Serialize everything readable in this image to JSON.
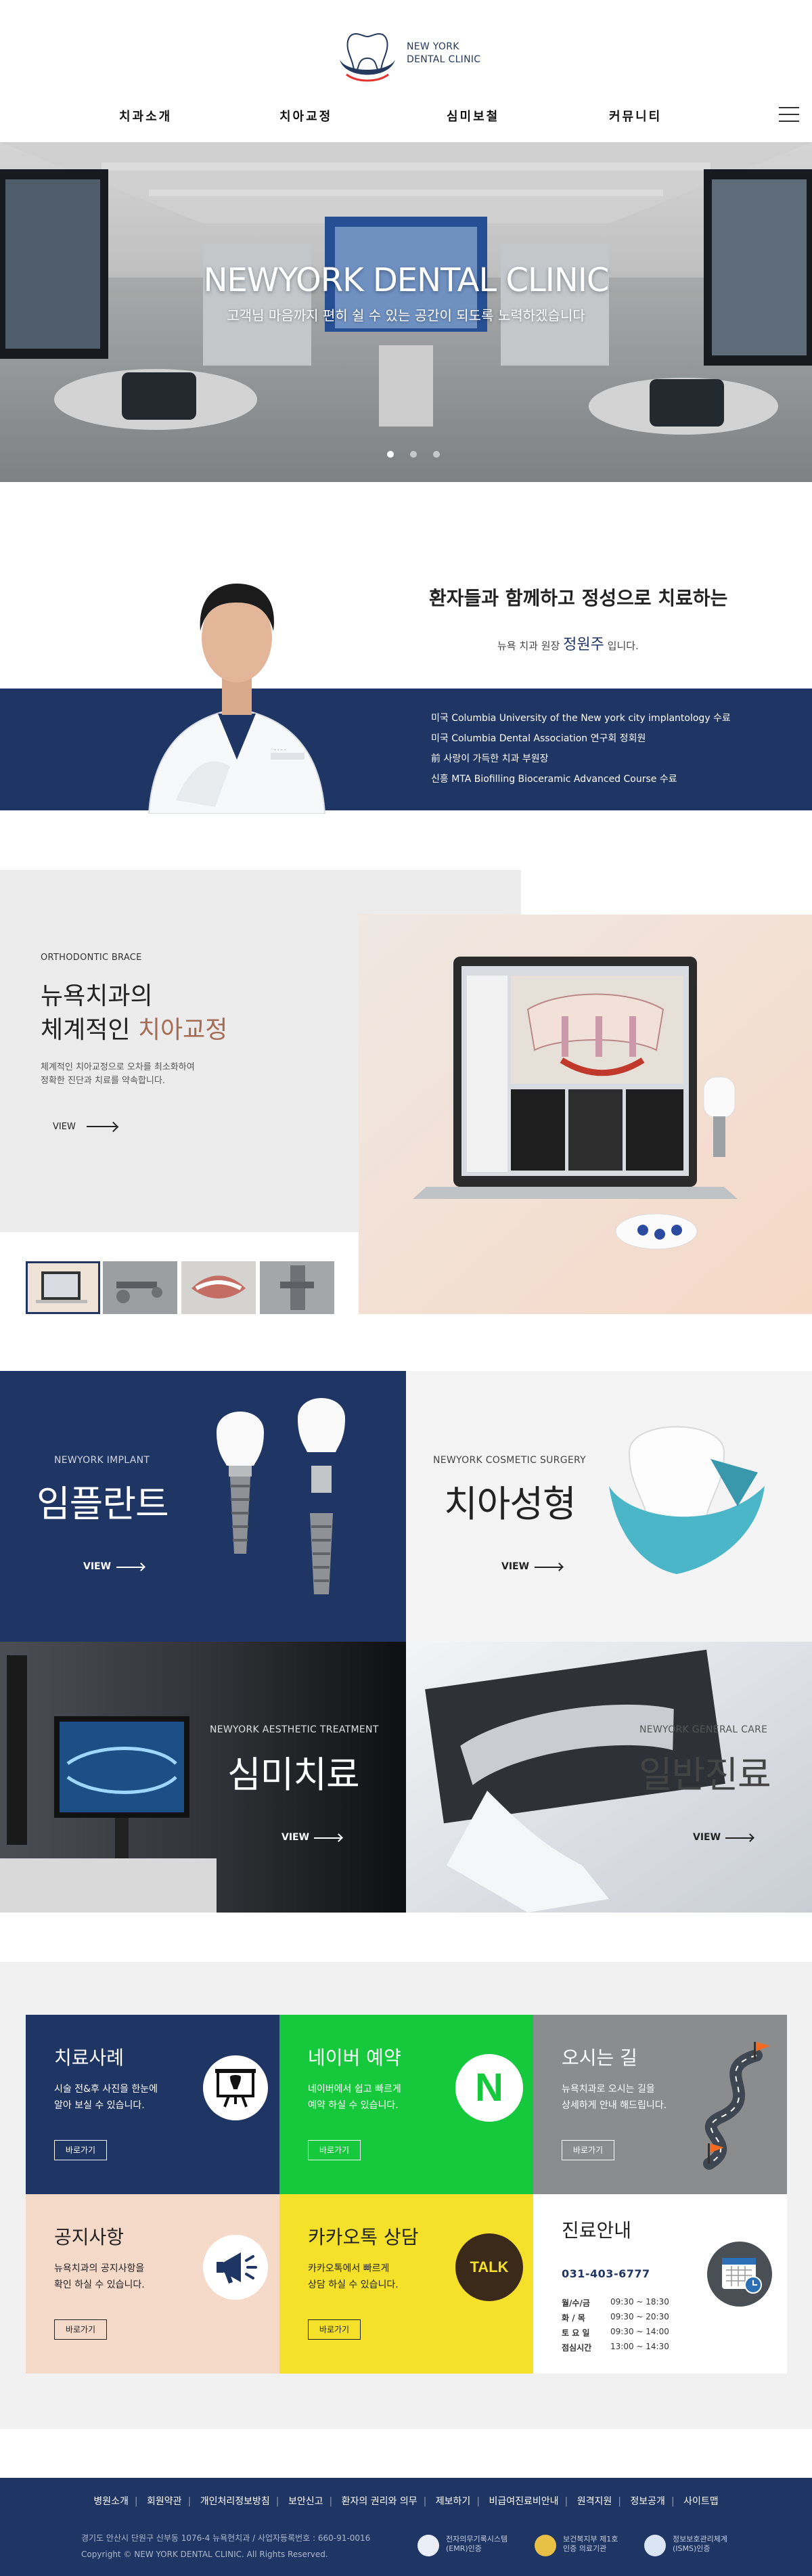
{
  "header": {
    "logo_line1": "NEW YORK",
    "logo_line2": "DENTAL CLINIC",
    "nav": [
      "치과소개",
      "치아교정",
      "심미보철",
      "커뮤니티"
    ]
  },
  "hero": {
    "title": "NEWYORK DENTAL CLINIC",
    "subtitle": "고객님 마음까지 편히 쉴 수 있는 공간이 되도록 노력하겠습니다",
    "slides": 3,
    "active_slide": 1
  },
  "doctor": {
    "headline": "환자들과 함께하고 정성으로 치료하는",
    "line_prefix": "뉴욕 치과  원장",
    "name": "정원주",
    "line_suffix": "입니다.",
    "credentials": [
      "미국 Columbia University of the New york city implantology 수료",
      "미국 Columbia Dental Association 연구회 정회원",
      "前 사랑이 가득한 치과 부원장",
      "신흥 MTA Biofilling Bioceramic Advanced Course 수료"
    ]
  },
  "ortho": {
    "tag": "ORTHODONTIC BRACE",
    "title_line1": "뉴욕치과의",
    "title_line2_prefix": "체계적인 ",
    "title_line2_accent": "치아교정",
    "desc_line1": "체계적인 치아교정으로 오차를 최소화하여",
    "desc_line2": "정확한 진단과 치료를 약속합니다.",
    "view_label": "VIEW"
  },
  "services": [
    {
      "tag": "NEWYORK IMPLANT",
      "title": "임플란트",
      "view": "VIEW"
    },
    {
      "tag": "NEWYORK COSMETIC SURGERY",
      "title": "치아성형",
      "view": "VIEW"
    },
    {
      "tag": "NEWYORK AESTHETIC TREATMENT",
      "title": "심미치료",
      "view": "VIEW"
    },
    {
      "tag": "NEWYORK GENERAL CARE",
      "title": "일반진료",
      "view": "VIEW"
    }
  ],
  "info": {
    "cases": {
      "title": "치료사례",
      "desc1": "시술 전&후 사진을 한눈에",
      "desc2": "알아 보실 수 있습니다.",
      "button": "바로가기"
    },
    "naver": {
      "title": "네이버 예약",
      "desc1": "네이버에서 쉽고 빠르게",
      "desc2": "예약 하실 수 있습니다.",
      "button": "바로가기",
      "badge": "N"
    },
    "directions": {
      "title": "오시는 길",
      "desc1": "뉴욕치과로 오시는 길을",
      "desc2": "상세하게 안내 해드립니다.",
      "button": "바로가기"
    },
    "notice": {
      "title": "공지사항",
      "desc1": "뉴욕치과의 공지사항을",
      "desc2": "확인 하실 수 있습니다.",
      "button": "바로가기"
    },
    "kakao": {
      "title": "카카오톡 상담",
      "desc1": "카카오톡에서 빠르게",
      "desc2": "상담 하실 수 있습니다.",
      "button": "바로가기",
      "badge": "TALK"
    },
    "hours": {
      "title": "진료안내",
      "phone": "031-403-6777",
      "rows": [
        {
          "day": "월/수/금",
          "time": "09:30 ~ 18:30"
        },
        {
          "day": "화 / 목",
          "time": "09:30 ~ 20:30"
        },
        {
          "day": "토 요 일",
          "time": "09:30 ~ 14:00"
        },
        {
          "day": "점심시간",
          "time": "13:00 ~ 14:30"
        }
      ]
    }
  },
  "footer": {
    "links": [
      "병원소개",
      "회원약관",
      "개인처리정보방침",
      "보안신고",
      "환자의 권리와 의무",
      "제보하기",
      "비급여진료비안내",
      "원격지원",
      "정보공개",
      "사이트맵"
    ],
    "address": "경기도 안산시 단원구 신부동 1076-4 뉴욕현치과 / 사업자등록번호 : 660-91-0016",
    "copyright": "Copyright © NEW YORK DENTAL CLINIC. All Rights Reserved.",
    "badges": [
      {
        "line1": "전자의무기록시스템",
        "line2": "(EMR)인증"
      },
      {
        "line1": "보건복지부 제1호",
        "line2": "인증 의료기관"
      },
      {
        "line1": "정보보호관리체계",
        "line2": "(ISMS)인증"
      }
    ]
  },
  "colors": {
    "navy": "#1f3563",
    "green": "#16c93c",
    "gray": "#8a8c8e",
    "peach": "#f6dac9",
    "yellow": "#f5e12a",
    "accent_brown": "#a56b53"
  }
}
